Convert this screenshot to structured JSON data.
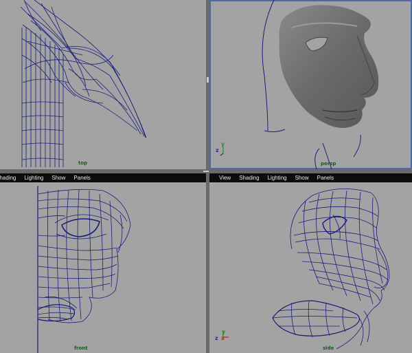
{
  "panels": {
    "top": {
      "camera_label": "top"
    },
    "persp": {
      "camera_label": "persp"
    },
    "front": {
      "camera_label": "front"
    },
    "side": {
      "camera_label": "side"
    }
  },
  "menubar": {
    "view": "View",
    "shading": "Shading",
    "lighting": "Lighting",
    "show": "Show",
    "panels": "Panels"
  },
  "axes": {
    "x": "x",
    "y": "y",
    "z": "z"
  },
  "colors": {
    "viewport_bg": "#a3a3a3",
    "wire": "#1b1b7a",
    "menubar_bg": "#0c0c0c",
    "camera_label": "#1c5a1c",
    "active_border": "#4b6aa3"
  }
}
